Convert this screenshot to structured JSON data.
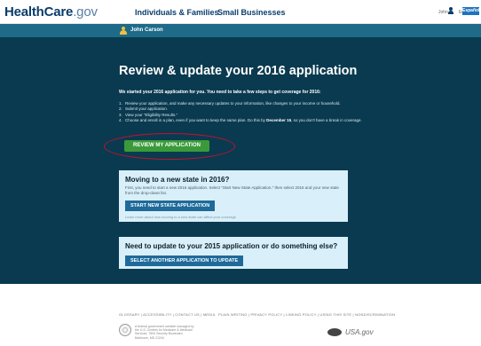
{
  "header": {
    "logo_main": "HealthCare",
    "logo_suffix": ".gov",
    "nav": [
      "Individuals & Families",
      "Small Businesses"
    ],
    "user_short": "John",
    "language_link": "English",
    "espanol": "Español"
  },
  "userbar": {
    "name": "John Carson"
  },
  "main": {
    "title": "Review & update your 2016 application",
    "intro": "We started your 2016 application for you. You need to take a few steps to get coverage for 2016:",
    "steps": [
      {
        "num": "1.",
        "text": "Review your application, and make any necessary updates to your information, like changes to your income or household."
      },
      {
        "num": "2.",
        "text": "Submit your application."
      },
      {
        "num": "3.",
        "text": "View your \"Eligibility Results.\""
      },
      {
        "num": "4.",
        "text_before": "Choose and enroll in a plan, even if you want to keep the same plan. Do this by ",
        "deadline": "December 15",
        "text_after": ", so you don't have a break in coverage."
      }
    ],
    "review_button": "REVIEW MY APPLICATION"
  },
  "move_card": {
    "title": "Moving to a new state in 2016?",
    "text": "First, you need to start a new 2016 application. Select \"Start New State Application,\" then select 2016 and your new state from the drop-down list.",
    "button": "START NEW STATE APPLICATION",
    "link": "Learn more about how moving to a new state can affect your coverage"
  },
  "update_card": {
    "title": "Need to update to your 2015 application or do something else?",
    "button": "SELECT ANOTHER APPLICATION TO UPDATE"
  },
  "footer": {
    "links_left": "GLOSSARY  |  ACCESSIBILITY  |  CONTACT US  |  MEDIA",
    "links_right": "PLAIN WRITING  |  PRIVACY POLICY  |  LINKING POLICY  |  USING THIS SITE  |  NONDISCRIMINATION",
    "small_lines": [
      "A federal government website managed by",
      "the U.S. Centers for Medicare & Medicaid",
      "Services. 7500 Security Boulevard,",
      "Baltimore, MD 21244"
    ],
    "usagov": "USA.gov"
  },
  "colors": {
    "panel": "#0a3a4f",
    "userbar": "#1e6a88",
    "review_button": "#3a9a3a",
    "card_bg": "#d9eff9",
    "card_button": "#1e6a9a",
    "highlight": "#c8102e"
  }
}
